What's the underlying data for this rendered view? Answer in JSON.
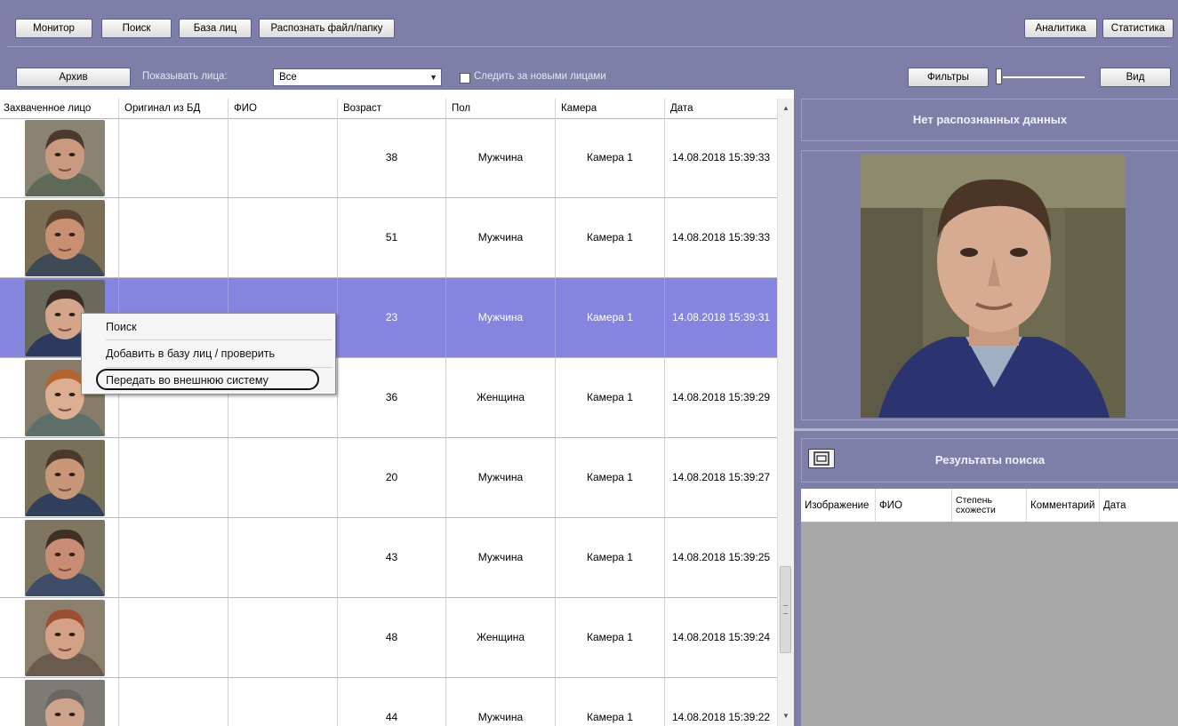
{
  "toolbar": {
    "monitor": "Монитор",
    "search": "Поиск",
    "face_db": "База лиц",
    "recognize": "Распознать файл/папку",
    "analytics": "Аналитика",
    "statistics": "Статистика",
    "archive": "Архив",
    "show_faces_label": "Показывать лица:",
    "show_faces_value": "Все",
    "follow_new_label": "Следить за новыми лицами",
    "filters": "Фильтры",
    "view": "Вид"
  },
  "table": {
    "columns": [
      "Захваченное лицо",
      "Оригинал из БД",
      "ФИО",
      "Возраст",
      "Пол",
      "Камера",
      "Дата"
    ],
    "rows": [
      {
        "age": "38",
        "gender": "Мужчина",
        "camera": "Камера 1",
        "date": "14.08.2018 15:39:33"
      },
      {
        "age": "51",
        "gender": "Мужчина",
        "camera": "Камера 1",
        "date": "14.08.2018 15:39:33"
      },
      {
        "age": "23",
        "gender": "Мужчина",
        "camera": "Камера 1",
        "date": "14.08.2018 15:39:31"
      },
      {
        "age": "36",
        "gender": "Женщина",
        "camera": "Камера 1",
        "date": "14.08.2018 15:39:29"
      },
      {
        "age": "20",
        "gender": "Мужчина",
        "camera": "Камера 1",
        "date": "14.08.2018 15:39:27"
      },
      {
        "age": "43",
        "gender": "Мужчина",
        "camera": "Камера 1",
        "date": "14.08.2018 15:39:25"
      },
      {
        "age": "48",
        "gender": "Женщина",
        "camera": "Камера 1",
        "date": "14.08.2018 15:39:24"
      },
      {
        "age": "44",
        "gender": "Мужчина",
        "camera": "Камера 1",
        "date": "14.08.2018 15:39:22"
      }
    ]
  },
  "context_menu": {
    "items": [
      "Поиск",
      "Добавить в базу лиц / проверить",
      "Передать во внешнюю систему"
    ]
  },
  "right_panel": {
    "no_data": "Нет распознанных данных",
    "results_title": "Результаты поиска",
    "results_columns": [
      "Изображение",
      "ФИО",
      "Степень схожести",
      "Комментарий",
      "Дата"
    ]
  },
  "colors": {
    "panel_bg": "#7e7fa8",
    "selected_row": "#8585e0"
  }
}
